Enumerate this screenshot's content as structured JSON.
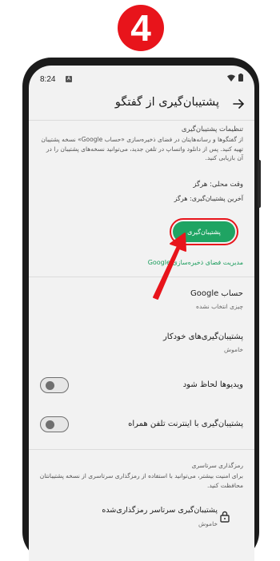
{
  "step_badge": "4",
  "status_bar": {
    "time": "8:24",
    "notification": "A"
  },
  "appbar": {
    "title": "پشتیبان‌گیری از گفتگو"
  },
  "backup_settings": {
    "section_title": "تنظیمات پشتیبان‌گیری",
    "description": "از گفتگوها و رسانه‌هایتان در فضای ذخیره‌سازی «حساب Google» نسخه پشتیبان تهیه کنید. پس از دانلود واتساپ در تلفن جدید، می‌توانید نسخه‌های پشتیبان را در آن بازیابی کنید.",
    "local_time": "وقت محلی: هرگز",
    "last_backup": "آخرین پشتیبان‌گیری: هرگز",
    "backup_button": "پشتیبان‌گیری",
    "manage_storage_link": "مدیریت فضای ذخیره‌سازی Google"
  },
  "google_account": {
    "title": "حساب Google",
    "subtitle": "چیزی انتخاب نشده"
  },
  "auto_backup": {
    "title": "پشتیبان‌گیری‌های خودکار",
    "subtitle": "خاموش"
  },
  "include_videos": {
    "label": "ویدیوها لحاظ شود",
    "enabled": false
  },
  "cellular_backup": {
    "label": "پشتیبان‌گیری با اینترنت تلفن همراه",
    "enabled": false
  },
  "e2e_encryption": {
    "section_title": "رمزگذاری سرتاسری",
    "description": "برای امنیت بیشتر، می‌توانید با استفاده از رمزگذاری سرتاسری از نسخه پشتیبانتان محافظت کنید.",
    "item_title": "پشتیبان‌گیری سرتاسر رمزگذاری‌شده",
    "item_subtitle": "خاموش"
  },
  "colors": {
    "badge": "#e8141b",
    "primary_button": "#1fa463",
    "link": "#1a9c5c",
    "highlight": "#e8141b"
  }
}
